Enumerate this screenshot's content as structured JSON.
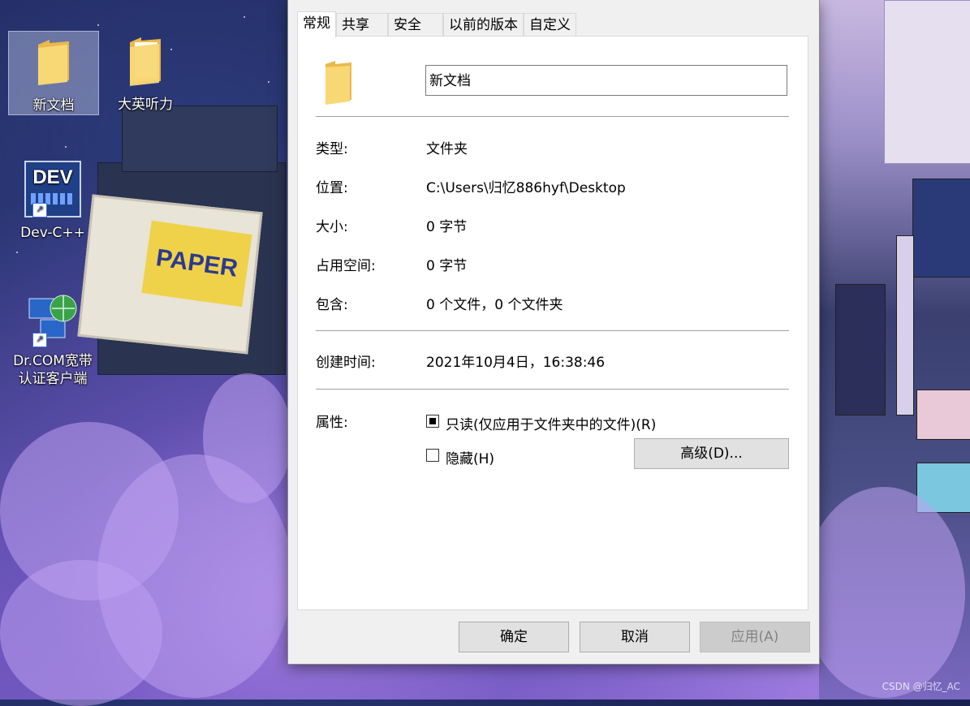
{
  "desktop": {
    "icons": [
      {
        "label": "新文档",
        "type": "folder"
      },
      {
        "label": "大英听力",
        "type": "folder"
      },
      {
        "label": "Dev-C++",
        "type": "app-shortcut",
        "badge": "DEV"
      },
      {
        "label": "Dr.COM宽带认证客户端",
        "type": "app-shortcut"
      }
    ],
    "scenery_sign_text": "PAPER",
    "watermark": "CSDN @归忆_AC"
  },
  "dialog": {
    "tabs": [
      {
        "label": "常规",
        "active": true
      },
      {
        "label": "共享",
        "active": false
      },
      {
        "label": "安全",
        "active": false
      },
      {
        "label": "以前的版本",
        "active": false
      },
      {
        "label": "自定义",
        "active": false
      }
    ],
    "folder_icon": "folder-icon",
    "name_value": "新文档",
    "type_label": "类型:",
    "type_value": "文件夹",
    "location_label": "位置:",
    "location_value": "C:\\Users\\归忆886hyf\\Desktop",
    "size_label": "大小:",
    "size_value": "0 字节",
    "size_on_disk_label": "占用空间:",
    "size_on_disk_value": "0 字节",
    "contains_label": "包含:",
    "contains_value": "0 个文件，0 个文件夹",
    "created_label": "创建时间:",
    "created_value": "2021年10月4日，16:38:46",
    "attributes_label": "属性:",
    "readonly_label": "只读(仅应用于文件夹中的文件)(R)",
    "readonly_state": "indeterminate",
    "hidden_label": "隐藏(H)",
    "hidden_checked": false,
    "advanced_button": "高级(D)...",
    "ok_button": "确定",
    "cancel_button": "取消",
    "apply_button": "应用(A)",
    "apply_enabled": false
  },
  "colors": {
    "dialog_bg": "#f0f0f0",
    "button_bg": "#e1e1e1",
    "folder_yellow": "#f8d775"
  }
}
